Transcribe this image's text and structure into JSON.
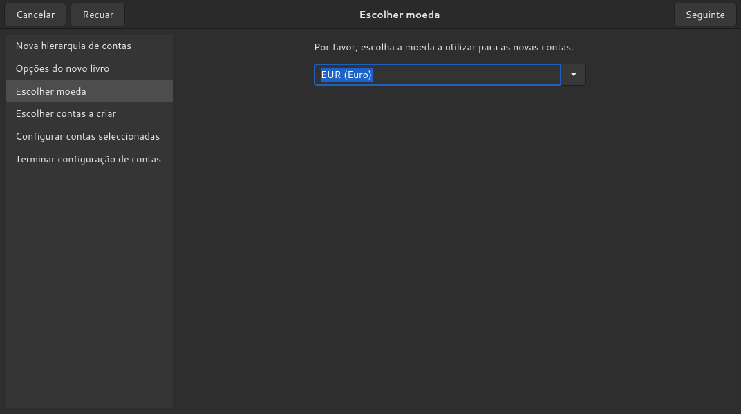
{
  "header": {
    "cancel_label": "Cancelar",
    "back_label": "Recuar",
    "title": "Escolher moeda",
    "next_label": "Seguinte"
  },
  "sidebar": {
    "items": [
      {
        "label": "Nova hierarquia de contas",
        "active": false
      },
      {
        "label": "Opções do novo livro",
        "active": false
      },
      {
        "label": "Escolher moeda",
        "active": true
      },
      {
        "label": "Escolher contas a criar",
        "active": false
      },
      {
        "label": "Configurar contas seleccionadas",
        "active": false
      },
      {
        "label": "Terminar configuração de contas",
        "active": false
      }
    ]
  },
  "main": {
    "instruction": "Por favor, escolha a moeda a utilizar para as novas contas.",
    "currency_selected": "EUR (Euro)"
  }
}
